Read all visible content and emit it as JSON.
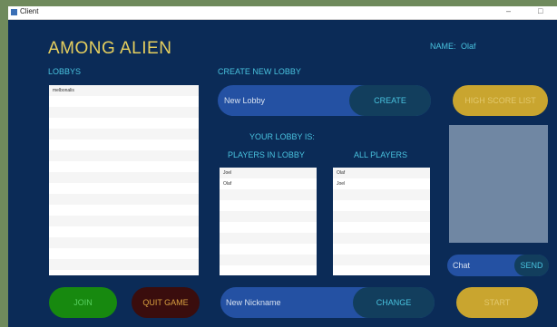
{
  "window": {
    "title": "Client",
    "minimize_glyph": "–",
    "maximize_glyph": "□"
  },
  "app": {
    "title": "AMONG ALIEN"
  },
  "user": {
    "name_label": "NAME:",
    "name_value": "Olaf"
  },
  "lobbies": {
    "label": "LOBBYS",
    "items": [
      "melbonalis"
    ]
  },
  "create_lobby": {
    "label": "CREATE NEW LOBBY",
    "placeholder": "New Lobby",
    "button": "CREATE"
  },
  "lobby_info": {
    "your_lobby_label": "YOUR LOBBY IS:"
  },
  "players_in_lobby": {
    "label": "PLAYERS IN LOBBY",
    "items": [
      "Joel",
      "Olaf"
    ]
  },
  "all_players": {
    "label": "ALL PLAYERS",
    "items": [
      "Olaf",
      "Joel"
    ]
  },
  "highscore": {
    "button": "HIGH SCORE LIST"
  },
  "chat": {
    "placeholder": "Chat",
    "button": "SEND"
  },
  "bottom": {
    "join": "JOIN",
    "quit": "QUIT GAME",
    "nickname_placeholder": "New Nickname",
    "change": "CHANGE",
    "start": "START"
  },
  "colors": {
    "background": "#0b2b57",
    "accent_text": "#49c3df",
    "title": "#e6cf5e",
    "gold_button": "#c9a52f",
    "join_green": "#17890f",
    "quit_dark_red": "#3a0d0d",
    "input_blue": "#2451a3",
    "button_teal": "#123e5d"
  }
}
